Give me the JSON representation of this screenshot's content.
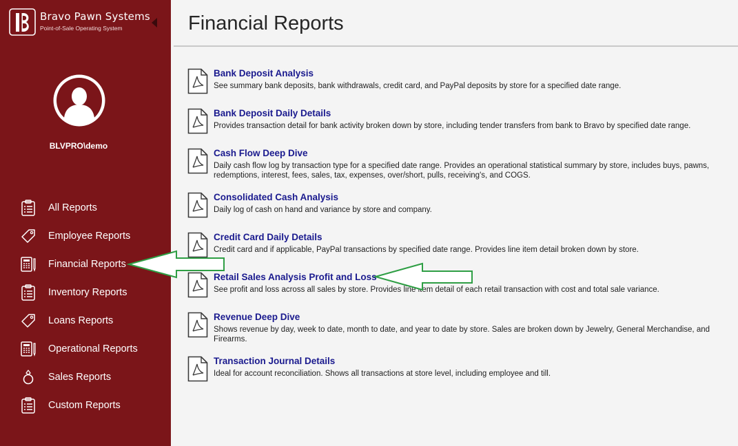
{
  "brand": {
    "name": "Bravo Pawn Systems",
    "tagline": "Point-of-Sale Operating System",
    "accent": "#7b1519"
  },
  "user": {
    "name": "BLVPRO\\demo"
  },
  "nav": {
    "items": [
      {
        "label": "All Reports",
        "icon": "clipboard-list-icon"
      },
      {
        "label": "Employee Reports",
        "icon": "tag-icon"
      },
      {
        "label": "Financial Reports",
        "icon": "calculator-icon"
      },
      {
        "label": "Inventory Reports",
        "icon": "clipboard-list-icon"
      },
      {
        "label": "Loans Reports",
        "icon": "tag-icon"
      },
      {
        "label": "Operational Reports",
        "icon": "calculator-icon"
      },
      {
        "label": "Sales Reports",
        "icon": "ring-icon"
      },
      {
        "label": "Custom Reports",
        "icon": "clipboard-list-icon"
      }
    ]
  },
  "page": {
    "title": "Financial Reports"
  },
  "reports": [
    {
      "title": "Bank Deposit Analysis",
      "description": "See summary bank deposits, bank withdrawals, credit card, and PayPal deposits by store for a specified date range."
    },
    {
      "title": "Bank Deposit Daily Details",
      "description": "Provides transaction detail for bank activity broken down by store, including tender transfers from bank to Bravo by specified date range."
    },
    {
      "title": "Cash Flow Deep Dive",
      "description": "Daily cash flow log by transaction type for a specified date range. Provides an operational statistical summary by store, includes buys, pawns, redemptions, interest, fees, sales, tax, expenses, over/short, pulls, receiving's, and COGS."
    },
    {
      "title": "Consolidated Cash Analysis",
      "description": "Daily log of cash on hand and variance by store and company."
    },
    {
      "title": "Credit Card Daily Details",
      "description": "Credit card and if applicable, PayPal transactions by specified date range. Provides line item detail broken down by store."
    },
    {
      "title": "Retail Sales Analysis Profit and Loss",
      "description": "See profit and loss across all sales by store. Provides line item detail of each retail transaction with cost and total sale variance."
    },
    {
      "title": "Revenue Deep Dive",
      "description": "Shows revenue by day, week to date, month to date, and year to date by store. Sales are broken down by Jewelry, General Merchandise, and Firearms."
    },
    {
      "title": "Transaction Journal Details",
      "description": "Ideal for account reconciliation. Shows all transactions at store level, including employee and till."
    }
  ],
  "annotations": {
    "arrow_color": "#2e9e44",
    "icon": "annotation-arrow-icon"
  }
}
